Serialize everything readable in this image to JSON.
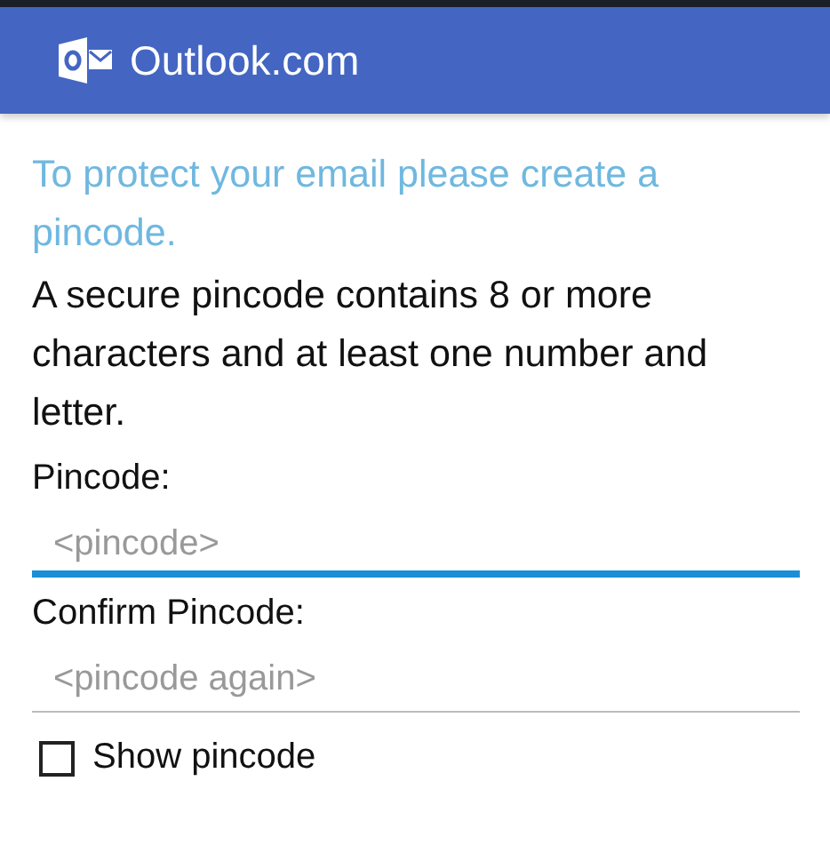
{
  "app_bar": {
    "title": "Outlook.com"
  },
  "intro": "To protect your email please create a pincode.",
  "description": "A secure pincode contains 8 or more characters and at least one number and letter.",
  "fields": [
    {
      "label": "Pincode:",
      "placeholder": "<pincode>",
      "focused": true
    },
    {
      "label": "Confirm Pincode:",
      "placeholder": "<pincode again>",
      "focused": false
    }
  ],
  "show_pincode": {
    "label": "Show pincode",
    "checked": false
  }
}
